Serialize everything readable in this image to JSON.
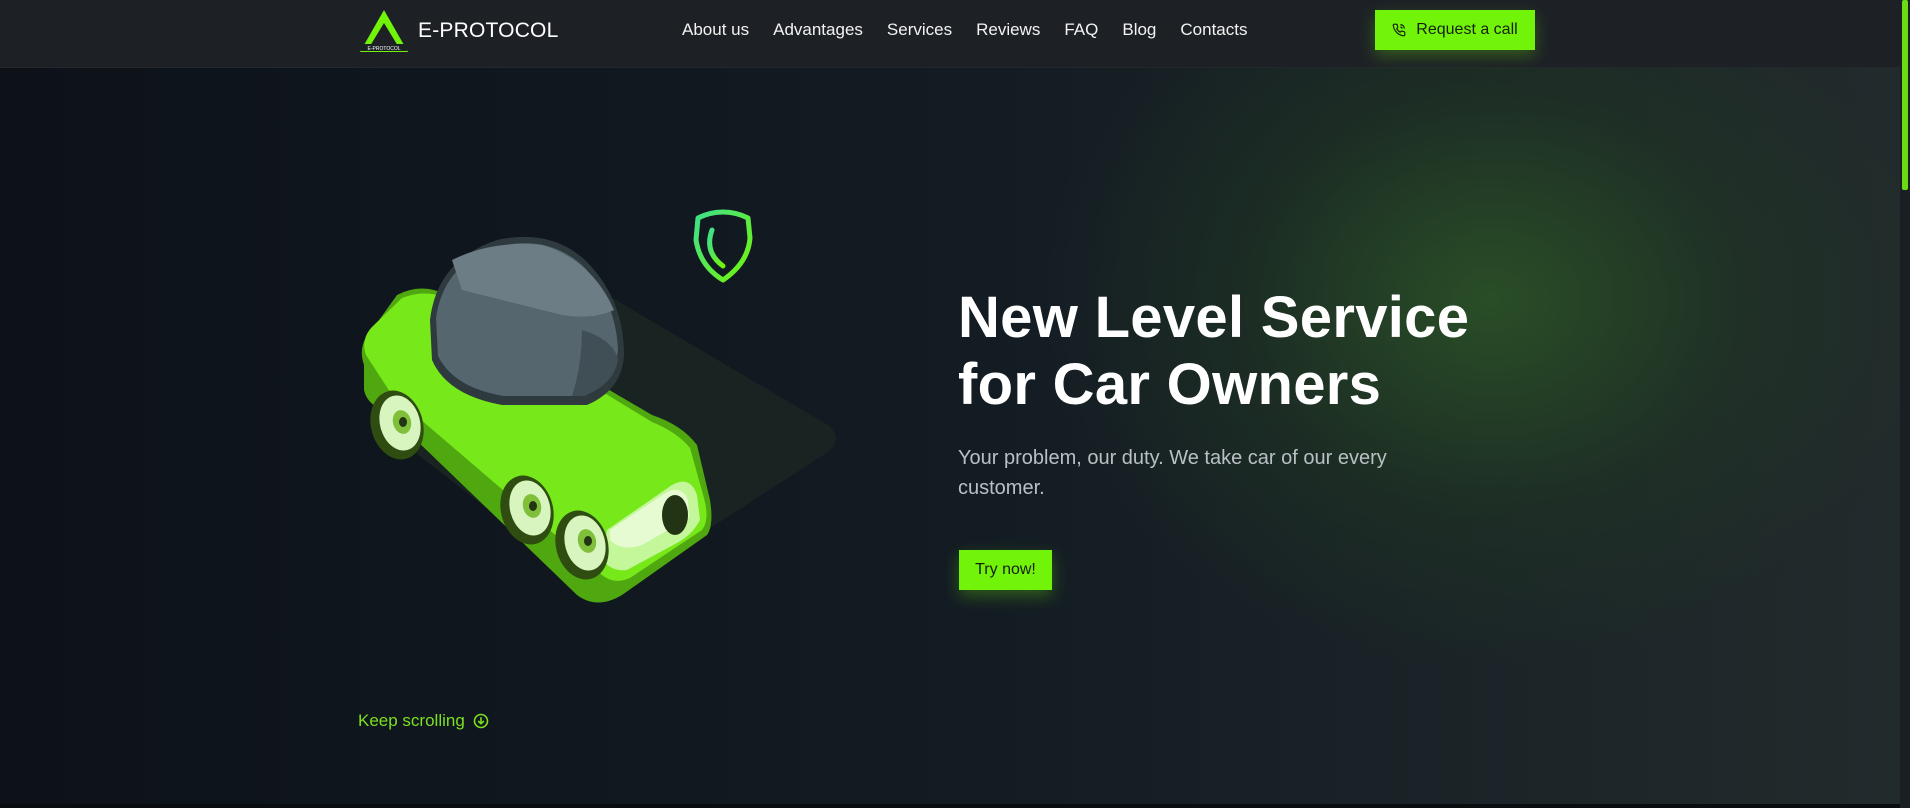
{
  "brand": {
    "name": "E-PROTOCOL",
    "mark_text": "E-PROTOCOL",
    "accent_color": "#72f40a"
  },
  "nav": {
    "items": [
      {
        "label": "About us"
      },
      {
        "label": "Advantages"
      },
      {
        "label": "Services"
      },
      {
        "label": "Reviews"
      },
      {
        "label": "FAQ"
      },
      {
        "label": "Blog"
      },
      {
        "label": "Contacts"
      }
    ]
  },
  "header": {
    "cta_label": "Request a call",
    "cta_icon": "phone-icon"
  },
  "hero": {
    "title_line1": "New Level Service",
    "title_line2": "for Car Owners",
    "subtitle": "Your problem, our duty. We take car of our every customer.",
    "button_label": "Try now!",
    "illustration": "green-car-illustration",
    "badge_icon": "shield-icon"
  },
  "footer_hint": {
    "label": "Keep scrolling",
    "icon": "arrow-down-circle-icon"
  }
}
